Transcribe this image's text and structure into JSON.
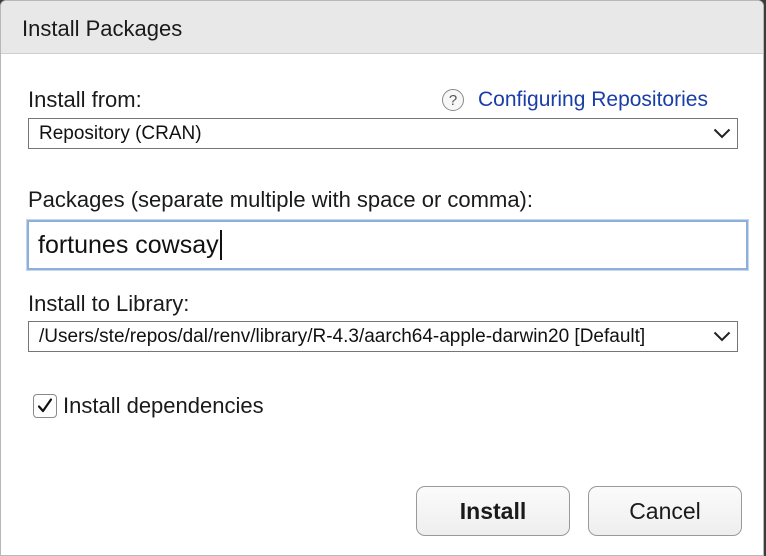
{
  "dialog": {
    "title": "Install Packages"
  },
  "install_from": {
    "label": "Install from:",
    "selected": "Repository (CRAN)"
  },
  "help": {
    "icon": "question-mark-icon",
    "glyph": "?",
    "link_text": "Configuring Repositories"
  },
  "packages": {
    "label": "Packages (separate multiple with space or comma):",
    "value": "fortunes cowsay"
  },
  "library": {
    "label": "Install to Library:",
    "selected": "/Users/ste/repos/dal/renv/library/R-4.3/aarch64-apple-darwin20 [Default]"
  },
  "dependencies": {
    "label": "Install dependencies",
    "checked": true
  },
  "buttons": {
    "install": "Install",
    "cancel": "Cancel"
  },
  "colors": {
    "link": "#1a3ea8",
    "focus_ring": "#8eaedb",
    "titlebar": "#e8e8e8"
  }
}
